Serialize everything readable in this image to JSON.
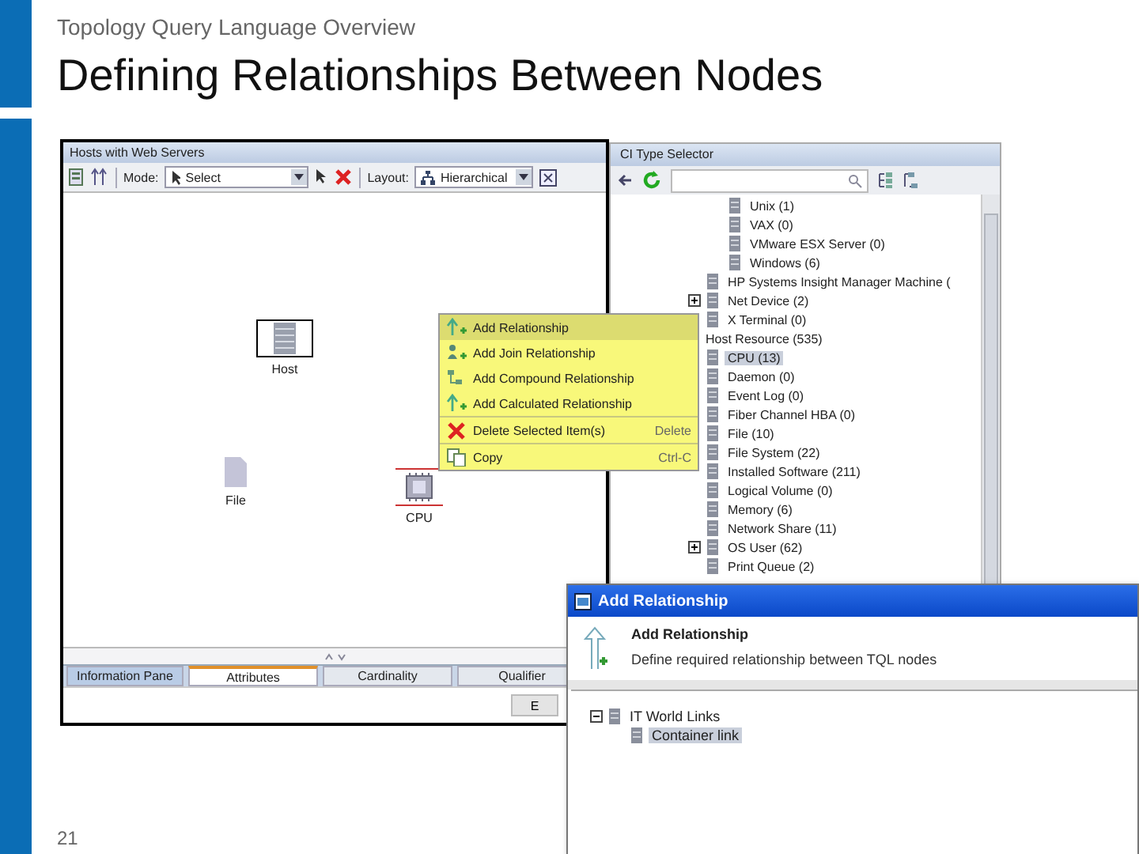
{
  "slide": {
    "section": "Topology Query Language Overview",
    "title": "Defining Relationships Between Nodes",
    "page_number": "21"
  },
  "query_window": {
    "title": "Hosts with Web Servers",
    "toolbar": {
      "mode_label": "Mode:",
      "mode_value": "Select",
      "layout_label": "Layout:",
      "layout_value": "Hierarchical"
    },
    "nodes": [
      {
        "kind": "host",
        "label": "Host",
        "selected": false
      },
      {
        "kind": "file",
        "label": "File",
        "selected": false
      },
      {
        "kind": "cpu",
        "label": "CPU",
        "selected": true
      }
    ],
    "tabs": [
      {
        "label": "Information Pane",
        "selected": false
      },
      {
        "label": "Attributes",
        "selected": true
      },
      {
        "label": "Cardinality",
        "selected": false
      },
      {
        "label": "Qualifier",
        "selected": false
      }
    ],
    "button": "E"
  },
  "context_menu": [
    {
      "kind": "add",
      "label": "Add Relationship",
      "selected": true
    },
    {
      "kind": "join",
      "label": "Add Join Relationship",
      "selected": false
    },
    {
      "kind": "compound",
      "label": "Add Compound Relationship",
      "selected": false
    },
    {
      "kind": "add",
      "label": "Add Calculated Relationship",
      "selected": false
    },
    {
      "kind": "delete",
      "label": "Delete Selected Item(s)",
      "shortcut": "Delete",
      "selected": false
    },
    {
      "kind": "copy",
      "label": "Copy",
      "shortcut": "Ctrl-C",
      "selected": false
    }
  ],
  "ci_type_selector": {
    "title": "CI Type Selector",
    "tree": [
      {
        "children": [
          {
            "children": [
              {
                "label": "Unix (1)",
                "selected": false
              },
              {
                "label": "VAX (0)",
                "selected": false
              },
              {
                "label": "VMware ESX Server (0)",
                "selected": false
              },
              {
                "label": "Windows (6)",
                "selected": false
              }
            ]
          },
          {
            "label": "HP Systems Insight Manager Machine (",
            "selected": false
          },
          {
            "label": "Net Device (2)",
            "selected": false,
            "expanded": false
          },
          {
            "label": "X Terminal (0)",
            "selected": false
          }
        ]
      },
      {
        "label": "Host Resource (535)",
        "selected": false,
        "children": [
          {
            "label": "CPU (13)",
            "selected": true
          },
          {
            "label": "Daemon (0)",
            "selected": false
          },
          {
            "label": "Event Log (0)",
            "selected": false
          },
          {
            "label": "Fiber Channel HBA (0)",
            "selected": false
          },
          {
            "label": "File (10)",
            "selected": false
          },
          {
            "label": "File System (22)",
            "selected": false
          },
          {
            "label": "Installed Software (211)",
            "selected": false
          },
          {
            "label": "Logical Volume (0)",
            "selected": false
          },
          {
            "label": "Memory (6)",
            "selected": false
          },
          {
            "label": "Network Share (11)",
            "selected": false
          },
          {
            "label": "OS User (62)",
            "selected": false,
            "expanded": false
          },
          {
            "label": "Print Queue (2)",
            "selected": false
          }
        ]
      }
    ]
  },
  "dialog": {
    "title": "Add Relationship",
    "heading": "Add Relationship",
    "description": "Define required relationship between TQL nodes",
    "tree": [
      {
        "label": "IT World Links",
        "selected": false,
        "expanded": true,
        "children": [
          {
            "label": "Container link",
            "selected": true
          }
        ]
      }
    ]
  }
}
